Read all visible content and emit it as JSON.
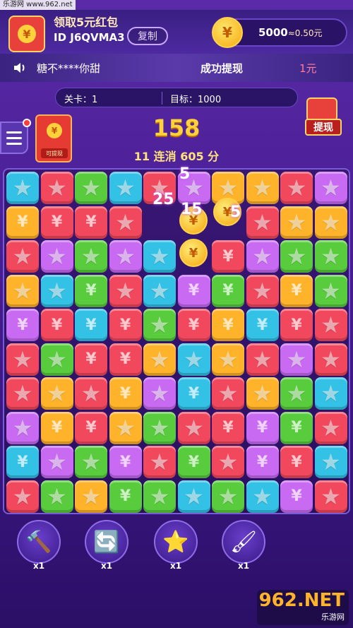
{
  "watermark_top": "乐游网 www.962.net",
  "header": {
    "redpack_title": "领取5元红包",
    "user_id": "ID J6QVMA3",
    "copy_label": "复制",
    "coin_symbol": "¥",
    "coin_balance": "5000",
    "coin_value": "≈0.50元"
  },
  "ticker": {
    "name": "糖不****你甜",
    "status": "成功提现",
    "amount": "1元"
  },
  "level": {
    "level_label": "关卡：1",
    "target_label": "目标：1000"
  },
  "withdraw_label": "提现",
  "mini_pack_label": "可提现",
  "score": "158",
  "combo": "11 连消 605 分",
  "board": {
    "colors": {
      "r": "#f2485d",
      "p": "#c86bf2",
      "g": "#58cc3d",
      "b": "#33c1e6",
      "y": "#ffb32a"
    },
    "rows": [
      [
        "b",
        "r",
        "g",
        "b",
        "r",
        "p",
        "y",
        "y",
        "r",
        "p"
      ],
      [
        "y",
        "r",
        "r",
        "r",
        "x",
        "x",
        "x",
        "r",
        "y",
        "y"
      ],
      [
        "r",
        "p",
        "g",
        "p",
        "b",
        "x",
        "r",
        "p",
        "g",
        "g"
      ],
      [
        "y",
        "b",
        "g",
        "r",
        "b",
        "p",
        "g",
        "r",
        "y",
        "g"
      ],
      [
        "p",
        "r",
        "b",
        "r",
        "g",
        "r",
        "y",
        "b",
        "r",
        "r"
      ],
      [
        "r",
        "g",
        "r",
        "r",
        "y",
        "b",
        "y",
        "r",
        "p",
        "r"
      ],
      [
        "r",
        "y",
        "r",
        "y",
        "p",
        "b",
        "r",
        "y",
        "g",
        "b"
      ],
      [
        "p",
        "y",
        "r",
        "y",
        "g",
        "r",
        "r",
        "p",
        "g",
        "r"
      ],
      [
        "b",
        "p",
        "g",
        "p",
        "r",
        "g",
        "r",
        "p",
        "r",
        "b"
      ],
      [
        "r",
        "g",
        "y",
        "g",
        "g",
        "b",
        "g",
        "b",
        "p",
        "r"
      ]
    ],
    "yen_cells": [
      "1-0",
      "1-1",
      "1-2",
      "2-6",
      "3-2",
      "3-5",
      "3-6",
      "3-8",
      "4-0",
      "4-1",
      "4-2",
      "4-3",
      "4-5",
      "4-6",
      "4-7",
      "4-8",
      "5-2",
      "5-3",
      "6-3",
      "6-5",
      "7-1",
      "7-2",
      "7-6",
      "7-7",
      "7-8",
      "8-0",
      "8-3",
      "8-5",
      "8-7",
      "8-8",
      "9-3",
      "9-8"
    ],
    "fx_numbers": [
      "5",
      "25",
      "15",
      "5"
    ]
  },
  "tools": [
    {
      "name": "hammer",
      "count": "x1"
    },
    {
      "name": "refresh",
      "count": "x1"
    },
    {
      "name": "magic-wand",
      "count": "x1"
    },
    {
      "name": "paint-brush",
      "count": "x1"
    }
  ],
  "watermark_bottom": {
    "big": "962.NET",
    "small": "乐游网"
  }
}
